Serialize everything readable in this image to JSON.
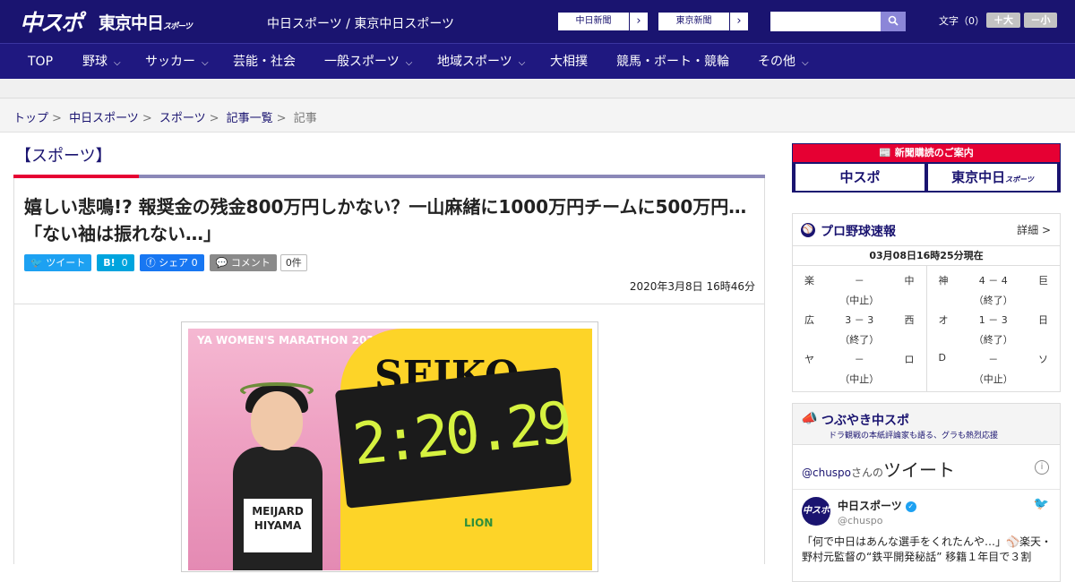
{
  "header": {
    "logo_main": "中スポ",
    "logo_tokyo": "東京中日",
    "logo_tokyo_small": "スポーツ",
    "site_name": "中日スポーツ / 東京中日スポーツ",
    "partner_links": [
      "中日新聞",
      "東京新聞"
    ],
    "partner_chevron": "›",
    "search_placeholder": "",
    "search_icon": "search-icon",
    "font_size_label": "文字（0）",
    "font_bigger": "＋大",
    "font_smaller": "－小"
  },
  "nav": {
    "items": [
      {
        "label": "TOP"
      },
      {
        "label": "野球"
      },
      {
        "label": "サッカー"
      },
      {
        "label": "芸能・社会"
      },
      {
        "label": "一般スポーツ"
      },
      {
        "label": "地域スポーツ"
      },
      {
        "label": "大相撲"
      },
      {
        "label": "競馬・ボート・競輪"
      },
      {
        "label": "その他"
      }
    ],
    "chevron": "⌵"
  },
  "breadcrumb": {
    "items": [
      "トップ",
      "中日スポーツ",
      "スポーツ",
      "記事一覧"
    ],
    "current": "記事",
    "separator": ">"
  },
  "article": {
    "category": "【スポーツ】",
    "headline": "嬉しい悲鳴!? 報奨金の残金800万円しかない？一山麻緒に1000万円チームに500万円…「ない袖は振れない…」",
    "share": {
      "tweet": "ツイート",
      "hatena_b": "B!",
      "hatena_count": "0",
      "facebook": "シェア",
      "facebook_count": "0",
      "comment": "コメント",
      "comment_count": "0件"
    },
    "date": "2020年3月8日 16時46分",
    "photo": {
      "board_brand": "SEIKO",
      "clock_time": "2:20.29",
      "sponsor": "LION",
      "banner": "YA WOMEN'S MARATHON 2020",
      "bib_name": "MEIJARD",
      "bib_name2": "HIYAMA"
    },
    "colors": {
      "accent_red": "#e60033",
      "brand_navy": "#1a1470"
    }
  },
  "sidebar": {
    "subscription": {
      "heading": "新聞購読のご案内",
      "btn_chuspo": "中スポ",
      "btn_tokyo": "東京中日",
      "btn_tokyo_small": "スポーツ"
    },
    "baseball": {
      "title": "プロ野球速報",
      "detail": "詳細 >",
      "as_of": "03月08日16時25分現在",
      "games_left": [
        {
          "home": "楽",
          "score": "－",
          "away": "中",
          "status": "（中止）"
        },
        {
          "home": "広",
          "score": "3 － 3",
          "away": "西",
          "status": "（終了）"
        },
        {
          "home": "ヤ",
          "score": "－",
          "away": "ロ",
          "status": "（中止）"
        }
      ],
      "games_right": [
        {
          "home": "神",
          "score": "4 － 4",
          "away": "巨",
          "status": "（終了）"
        },
        {
          "home": "オ",
          "score": "1 － 3",
          "away": "日",
          "status": "（終了）"
        },
        {
          "home": "D",
          "score": "－",
          "away": "ソ",
          "status": "（中止）"
        }
      ]
    },
    "tweets": {
      "title": "つぶやき中スポ",
      "subtitle": "ドラ観戦の本紙評論家も語る、グラも熱烈応援",
      "handle_link": "@chuspo",
      "san_no": "さんの",
      "tweet_word": "ツイート",
      "author": "中日スポーツ",
      "author_handle": "@chuspo",
      "text": "「何で中日はあんな選手をくれたんや…」⚾楽天・野村元監督の“鉄平開発秘話” 移籍１年目で３割"
    }
  }
}
